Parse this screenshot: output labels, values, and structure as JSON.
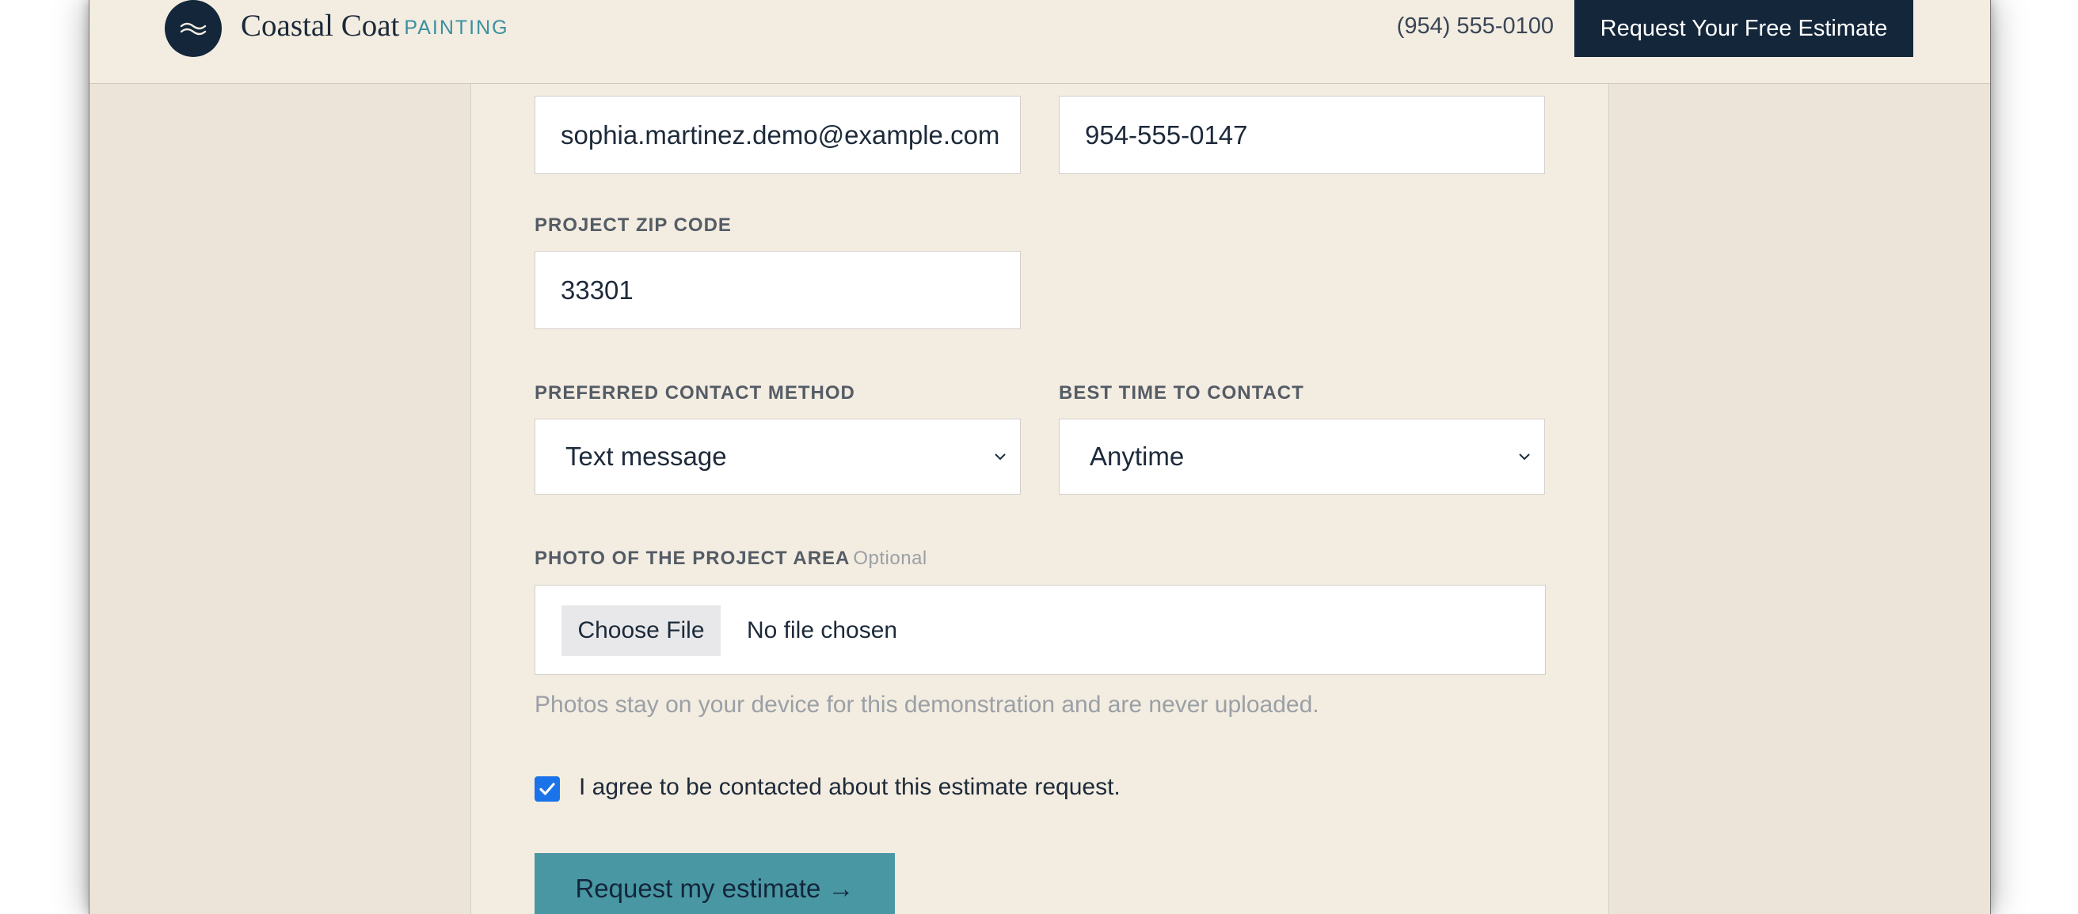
{
  "header": {
    "brand_name": "Coastal Coat",
    "brand_sub": "PAINTING",
    "phone": "(954) 555-0100",
    "cta_label": "Request Your Free Estimate"
  },
  "form": {
    "email_value": "sophia.martinez.demo@example.com",
    "phone_value": "954-555-0147",
    "zip_label": "PROJECT ZIP CODE",
    "zip_value": "33301",
    "contact_method_label": "PREFERRED CONTACT METHOD",
    "contact_method_value": "Text message",
    "best_time_label": "BEST TIME TO CONTACT",
    "best_time_value": "Anytime",
    "photo_label": "PHOTO OF THE PROJECT AREA",
    "photo_optional": "Optional",
    "choose_file_label": "Choose File",
    "no_file_text": "No file chosen",
    "photo_helper": "Photos stay on your device for this demonstration and are never uploaded.",
    "agree_text": "I agree to be contacted about this estimate request.",
    "agree_checked": true,
    "submit_label": "Request my estimate →"
  },
  "colors": {
    "navy": "#13263a",
    "teal": "#4a97a4",
    "cream": "#f3ece0",
    "checkbox": "#1a73e8"
  }
}
